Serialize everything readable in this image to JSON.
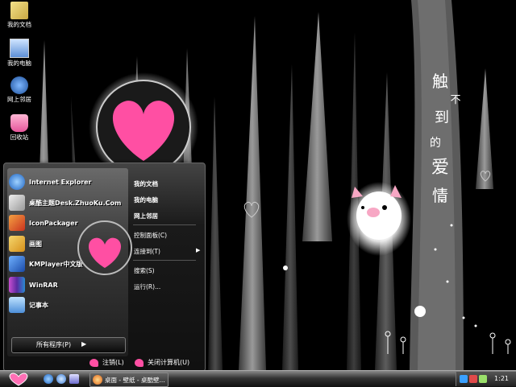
{
  "desktop_icons": [
    {
      "label": "我的文档",
      "icon": "my-documents-icon"
    },
    {
      "label": "我的电脑",
      "icon": "my-computer-icon"
    },
    {
      "label": "网上邻居",
      "icon": "network-places-icon"
    },
    {
      "label": "回收站",
      "icon": "recycle-bin-icon"
    }
  ],
  "wallpaper": {
    "chars": [
      "触",
      "不",
      "到",
      "的",
      "爱",
      "情"
    ]
  },
  "start_menu": {
    "programs": [
      {
        "label": "Internet Explorer",
        "icon": "internet-explorer-icon",
        "color": "#3a8ee6"
      },
      {
        "label": "桌酷主题Desk.ZhuoKu.Com",
        "icon": "zhuoku-icon",
        "color": "#c9c9c9"
      },
      {
        "label": "IconPackager",
        "icon": "iconpackager-icon",
        "color": "#d94c2a"
      },
      {
        "label": "画图",
        "icon": "paint-icon",
        "color": "#e0b040"
      },
      {
        "label": "KMPlayer中文版",
        "icon": "kmplayer-icon",
        "color": "#2a6fd6"
      },
      {
        "label": "WinRAR",
        "icon": "winrar-icon",
        "color": "#8a3aa8"
      },
      {
        "label": "记事本",
        "icon": "notepad-icon",
        "color": "#5aa0e0"
      }
    ],
    "all_programs": "所有程序(P)",
    "places": [
      {
        "label": "我的文档",
        "bold": true
      },
      {
        "label": "我的电脑",
        "bold": true
      },
      {
        "label": "网上邻居",
        "bold": true
      },
      {
        "label": "控制面板(C)",
        "bold": false
      },
      {
        "label": "连接到(T)",
        "bold": false
      },
      {
        "label": "搜索(S)",
        "bold": false
      },
      {
        "label": "运行(R)...",
        "bold": false
      }
    ],
    "logoff": "注销(L)",
    "shutdown": "关闭计算机(U)"
  },
  "taskbar": {
    "task_label": "桌面 - 壁纸 - 桌酷壁...",
    "clock": "1:21"
  },
  "colors": {
    "accent_pink": "#ff4fa3",
    "bg": "#000000"
  }
}
